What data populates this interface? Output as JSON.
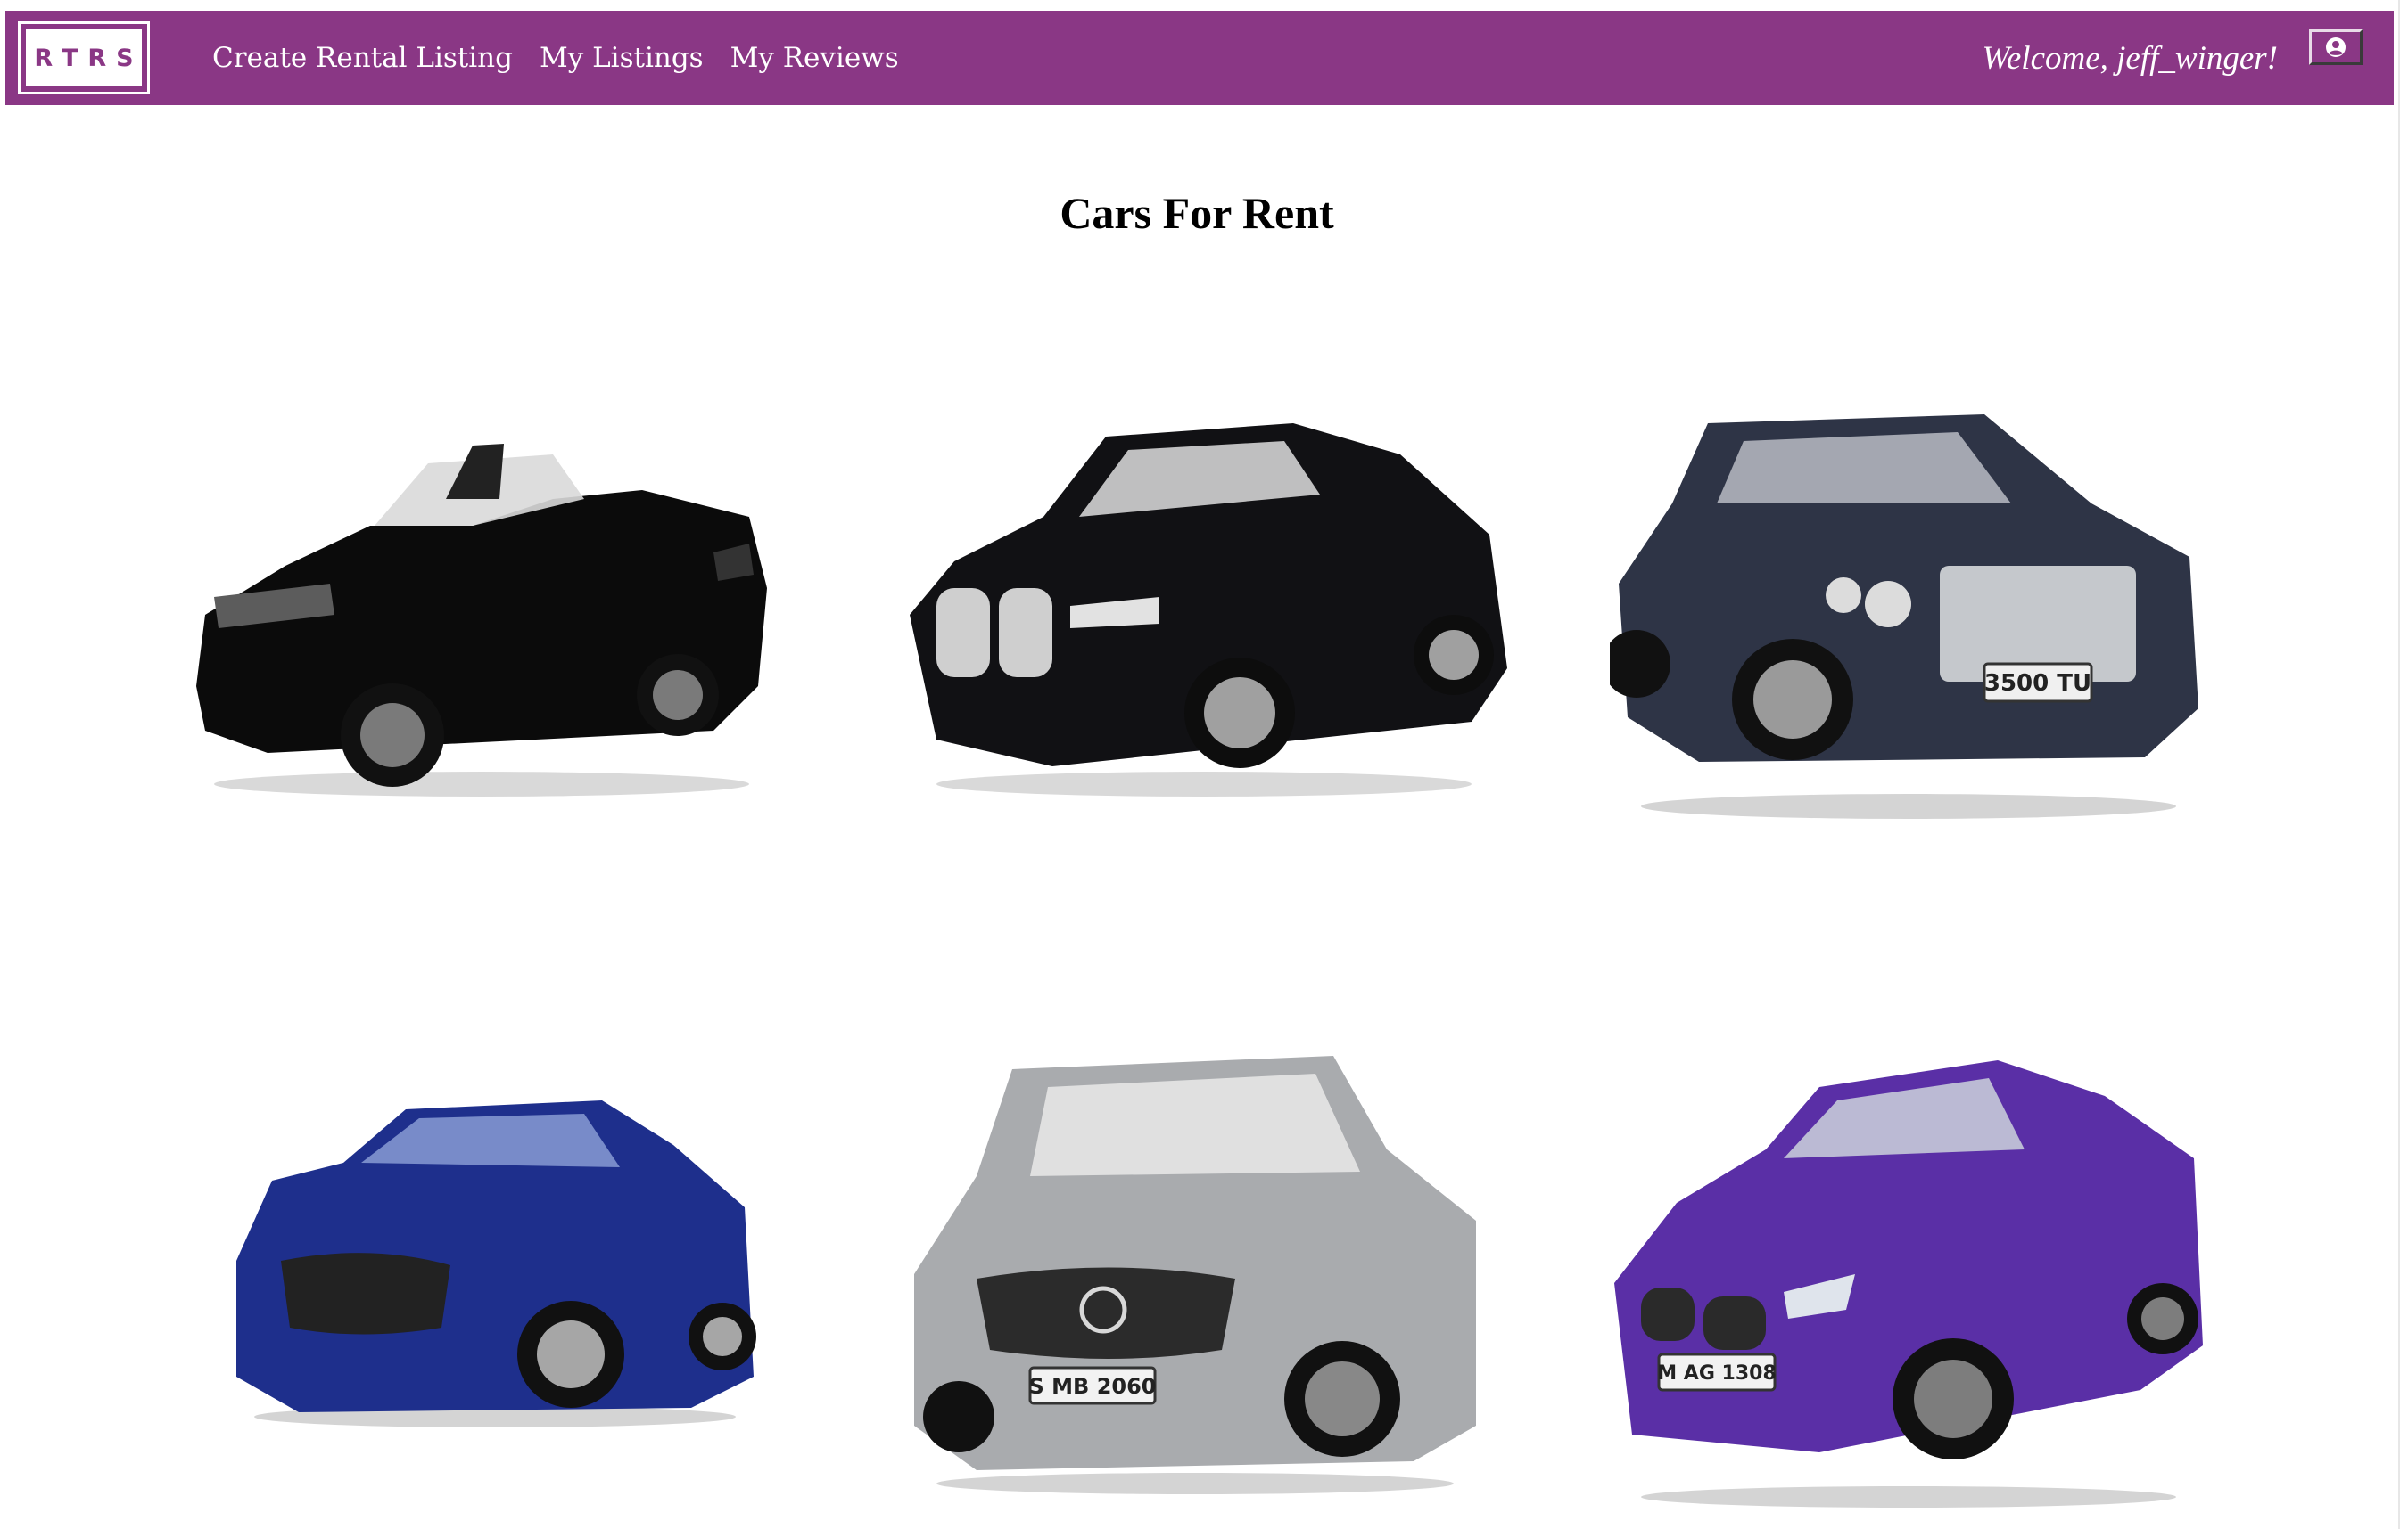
{
  "navbar": {
    "logo_text": "RTRS",
    "links": [
      {
        "label": "Create Rental Listing"
      },
      {
        "label": "My Listings"
      },
      {
        "label": "My Reviews"
      }
    ],
    "welcome_text": "Welcome, jeff_winger!",
    "profile_icon": "user-circle-icon",
    "background_color": "#8a3785"
  },
  "main": {
    "title": "Cars For Rent",
    "cars": [
      {
        "body_color": "#0b0b0b",
        "style": "convertible",
        "plate": ""
      },
      {
        "body_color": "#111114",
        "style": "sedan",
        "plate": ""
      },
      {
        "body_color": "#2e3446",
        "style": "luxury-sedan",
        "plate": "3500 TU"
      },
      {
        "body_color": "#1e2f8c",
        "style": "sedan",
        "plate": ""
      },
      {
        "body_color": "#a9abae",
        "style": "sedan",
        "plate": "S MB 2060"
      },
      {
        "body_color": "#5a2fa6",
        "style": "coupe",
        "plate": "M AG 1308"
      }
    ]
  }
}
